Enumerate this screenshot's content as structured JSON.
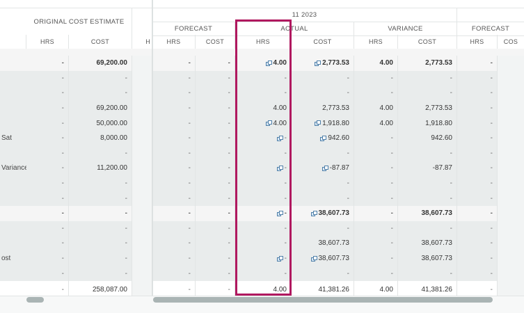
{
  "header": {
    "period": "11 2023",
    "groups": {
      "original_cost_estimate": "ORIGINAL COST ESTIMATE",
      "forecast": "FORECAST",
      "actual": "ACTUAL",
      "variance": "VARIANCE",
      "forecast2": "FORECAST"
    },
    "cols": {
      "oce_hrs": "HRS",
      "oce_cost": "COST",
      "h_cut": "H",
      "f_hrs": "HRS",
      "f_cost": "COST",
      "a_hrs": "HRS",
      "a_cost": "COST",
      "v_hrs": "HRS",
      "v_cost": "COST",
      "f2_hrs": "HRS",
      "f2_cost": "COS"
    }
  },
  "rows": [
    {
      "name": "",
      "oce_hrs": "-",
      "oce_cost": "69,200.00",
      "f_hrs": "-",
      "f_cost": "-",
      "a_hrs": "4.00",
      "a_hrs_icon": true,
      "a_cost": "2,773.53",
      "a_cost_icon": true,
      "v_hrs": "4.00",
      "v_cost": "2,773.53",
      "f2_hrs": "-",
      "style": "sub",
      "bold": true
    },
    {
      "name": "",
      "oce_hrs": "-",
      "oce_cost": "-",
      "f_hrs": "-",
      "f_cost": "-",
      "a_hrs": "-",
      "a_cost": "-",
      "v_hrs": "-",
      "v_cost": "-",
      "f2_hrs": "-",
      "style": "gray"
    },
    {
      "name": "",
      "oce_hrs": "-",
      "oce_cost": "-",
      "f_hrs": "-",
      "f_cost": "-",
      "a_hrs": "-",
      "a_cost": "-",
      "v_hrs": "-",
      "v_cost": "-",
      "f2_hrs": "-",
      "style": "gray"
    },
    {
      "name": "",
      "oce_hrs": "-",
      "oce_cost": "69,200.00",
      "f_hrs": "-",
      "f_cost": "-",
      "a_hrs": "4.00",
      "a_cost": "2,773.53",
      "v_hrs": "4.00",
      "v_cost": "2,773.53",
      "f2_hrs": "-",
      "style": "gray"
    },
    {
      "name": "",
      "oce_hrs": "-",
      "oce_cost": "50,000.00",
      "f_hrs": "-",
      "f_cost": "-",
      "a_hrs": "4.00",
      "a_hrs_icon": true,
      "a_cost": "1,918.80",
      "a_cost_icon": true,
      "v_hrs": "4.00",
      "v_cost": "1,918.80",
      "f2_hrs": "-",
      "style": "gray"
    },
    {
      "name": "Sat",
      "oce_hrs": "-",
      "oce_cost": "8,000.00",
      "f_hrs": "-",
      "f_cost": "-",
      "a_hrs": "-",
      "a_hrs_icon": true,
      "a_cost": "942.60",
      "a_cost_icon": true,
      "v_hrs": "-",
      "v_cost": "942.60",
      "f2_hrs": "-",
      "style": "gray"
    },
    {
      "name": "",
      "oce_hrs": "-",
      "oce_cost": "-",
      "f_hrs": "-",
      "f_cost": "-",
      "a_hrs": "-",
      "a_cost": "-",
      "v_hrs": "-",
      "v_cost": "-",
      "f2_hrs": "-",
      "style": "gray"
    },
    {
      "name": "Variance",
      "oce_hrs": "-",
      "oce_cost": "11,200.00",
      "f_hrs": "-",
      "f_cost": "-",
      "a_hrs": "-",
      "a_hrs_icon": true,
      "a_cost": "-87.87",
      "a_cost_icon": true,
      "v_hrs": "-",
      "v_cost": "-87.87",
      "f2_hrs": "-",
      "style": "gray"
    },
    {
      "name": "",
      "oce_hrs": "-",
      "oce_cost": "-",
      "f_hrs": "-",
      "f_cost": "-",
      "a_hrs": "-",
      "a_cost": "-",
      "v_hrs": "-",
      "v_cost": "-",
      "f2_hrs": "-",
      "style": "gray"
    },
    {
      "name": "",
      "oce_hrs": "-",
      "oce_cost": "-",
      "f_hrs": "-",
      "f_cost": "-",
      "a_hrs": "-",
      "a_cost": "-",
      "v_hrs": "-",
      "v_cost": "-",
      "f2_hrs": "-",
      "style": "gray"
    },
    {
      "name": "",
      "oce_hrs": "-",
      "oce_cost": "-",
      "f_hrs": "-",
      "f_cost": "-",
      "a_hrs": "-",
      "a_hrs_icon": true,
      "a_cost": "38,607.73",
      "a_cost_icon": true,
      "v_hrs": "-",
      "v_cost": "38,607.73",
      "f2_hrs": "-",
      "style": "sub",
      "bold": true
    },
    {
      "name": "",
      "oce_hrs": "-",
      "oce_cost": "-",
      "f_hrs": "-",
      "f_cost": "-",
      "a_hrs": "-",
      "a_cost": "-",
      "v_hrs": "-",
      "v_cost": "-",
      "f2_hrs": "-",
      "style": "gray"
    },
    {
      "name": "",
      "oce_hrs": "-",
      "oce_cost": "-",
      "f_hrs": "-",
      "f_cost": "-",
      "a_hrs": "-",
      "a_cost": "38,607.73",
      "v_hrs": "-",
      "v_cost": "38,607.73",
      "f2_hrs": "-",
      "style": "gray"
    },
    {
      "name": "ost",
      "oce_hrs": "-",
      "oce_cost": "-",
      "f_hrs": "-",
      "f_cost": "-",
      "a_hrs": "-",
      "a_hrs_icon": true,
      "a_cost": "38,607.73",
      "a_cost_icon": true,
      "v_hrs": "-",
      "v_cost": "38,607.73",
      "f2_hrs": "-",
      "style": "gray"
    },
    {
      "name": "",
      "oce_hrs": "-",
      "oce_cost": "-",
      "f_hrs": "-",
      "f_cost": "-",
      "a_hrs": "-",
      "a_cost": "-",
      "v_hrs": "-",
      "v_cost": "-",
      "f2_hrs": "-",
      "style": "gray"
    },
    {
      "name": "",
      "oce_hrs": "-",
      "oce_cost": "258,087.00",
      "f_hrs": "-",
      "f_cost": "-",
      "a_hrs": "4.00",
      "a_cost": "41,381.26",
      "v_hrs": "4.00",
      "v_cost": "41,381.26",
      "f2_hrs": "-",
      "style": "white"
    }
  ],
  "colors": {
    "highlight": "#b0185f",
    "icon": "#4d7ea8",
    "row_gray": "#e9ecec"
  }
}
